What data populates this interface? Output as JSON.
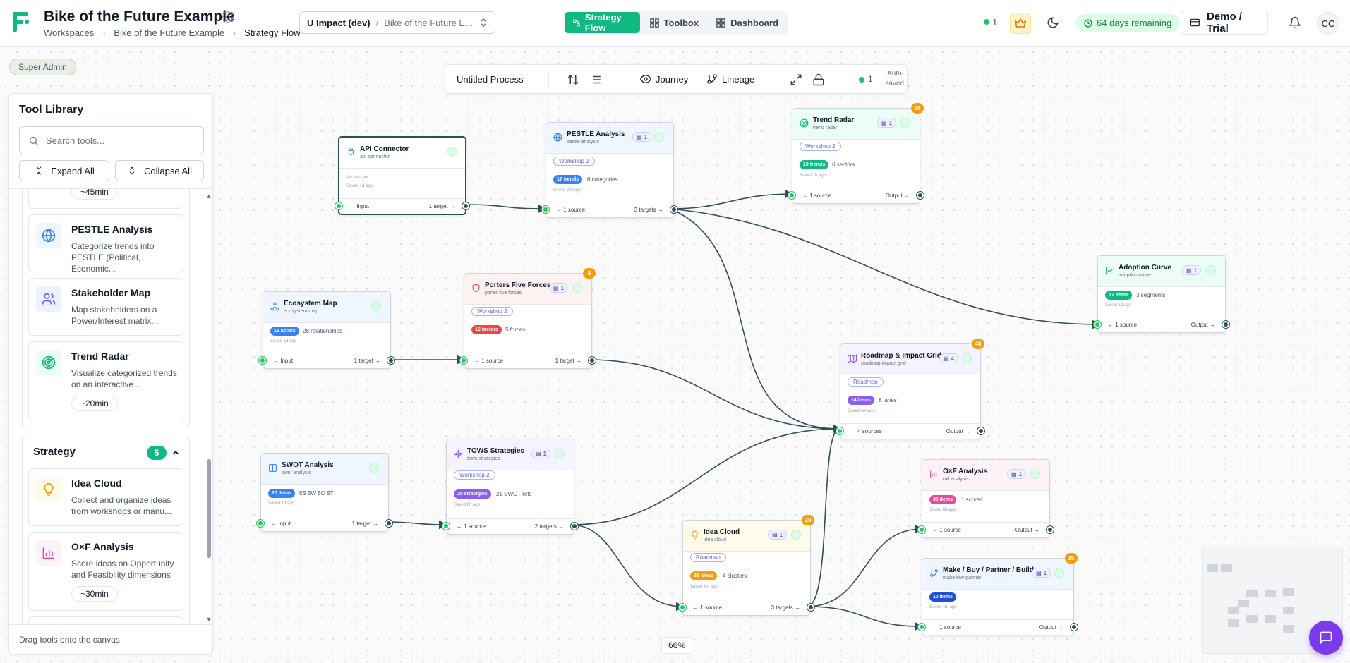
{
  "header": {
    "title": "Bike of the Future Example",
    "breadcrumb": [
      "Workspaces",
      "Bike of the Future Example",
      "Strategy Flow"
    ],
    "workspace_org": "U Impact (dev)",
    "workspace_sep": "/",
    "workspace_project": "Bike of the Future E...",
    "tabs": [
      {
        "label": "Strategy Flow",
        "icon": "flow-icon",
        "active": true
      },
      {
        "label": "Toolbox",
        "icon": "grid-icon",
        "active": false
      },
      {
        "label": "Dashboard",
        "icon": "grid-icon",
        "active": false
      }
    ],
    "online_count": "1",
    "trial_label": "64 days remaining",
    "plan_label": "Demo / Trial",
    "avatar_initials": "CC"
  },
  "admin_badge": "Super Admin",
  "process_bar": {
    "name": "Untitled Process",
    "journey_label": "Journey",
    "lineage_label": "Lineage",
    "presence_count": "1",
    "saved_line1": "Auto-",
    "saved_line2": "saved"
  },
  "library": {
    "title": "Tool Library",
    "search_placeholder": "Search tools...",
    "expand_label": "Expand All",
    "collapse_label": "Collapse All",
    "top_duration": "~45min",
    "tools": [
      {
        "name": "PESTLE Analysis",
        "desc": "Categorize trends into PESTLE (Political, Economic...",
        "icon": "globe-icon"
      },
      {
        "name": "Stakeholder Map",
        "desc": "Map stakeholders on a Power/Interest matrix...",
        "icon": "users-icon"
      },
      {
        "name": "Trend Radar",
        "desc": "Visualize categorized trends on an interactive...",
        "icon": "radar-icon",
        "duration": "~20min"
      }
    ],
    "strategy_section": {
      "label": "Strategy",
      "count": "5"
    },
    "strategy_tools": [
      {
        "name": "Idea Cloud",
        "desc": "Collect and organize ideas from workshops or manu...",
        "icon": "lightbulb-icon"
      },
      {
        "name": "O×F Analysis",
        "desc": "Score ideas on Opportunity and Feasibility dimensions",
        "icon": "bar-chart-icon",
        "duration": "~30min"
      }
    ],
    "footer_hint": "Drag tools onto the canvas"
  },
  "nodes": [
    {
      "id": "api",
      "title": "API Connector",
      "subtitle": "api connector",
      "empty_text": "No data yet",
      "saved": "Saved 1d ago",
      "in_label": "← Input",
      "out_label": "1 target →"
    },
    {
      "id": "pestle",
      "title": "PESTLE Analysis",
      "subtitle": "pestle analysis",
      "chip": "1",
      "tag": "Workshop 2",
      "pill": "17 trends",
      "meta": "6 categories",
      "saved": "Saved 20d ago",
      "in_label": "← 1 source",
      "out_label": "3 targets →"
    },
    {
      "id": "trend",
      "title": "Trend Radar",
      "subtitle": "trend radar",
      "chip": "1",
      "badge": "16",
      "tag": "Workshop 2",
      "pill": "19 trends",
      "meta": "6 sectors",
      "saved": "Saved 7h ago",
      "in_label": "← 1 source",
      "out_label": "Output →"
    },
    {
      "id": "adoption",
      "title": "Adoption Curve",
      "subtitle": "adoption curve",
      "chip": "1",
      "pill": "17 items",
      "meta": "3 segments",
      "saved": "Saved 1d ago",
      "in_label": "← 1 source",
      "out_label": "Output →"
    },
    {
      "id": "eco",
      "title": "Ecosystem Map",
      "subtitle": "ecosystem map",
      "pill": "15 actors",
      "meta": "28 relationships",
      "saved": "Saved 1d ago",
      "in_label": "← Input",
      "out_label": "1 target →"
    },
    {
      "id": "porter",
      "title": "Porters Five Forces",
      "subtitle": "porter five forces",
      "chip": "1",
      "badge": "8",
      "tag": "Workshop 2",
      "pill": "12 factors",
      "meta": "5 forces",
      "in_label": "← 1 source",
      "out_label": "1 target →"
    },
    {
      "id": "roadmap",
      "title": "Roadmap & Impact Grid",
      "subtitle": "roadmap impact grid",
      "chip": "4",
      "badge": "46",
      "tag": "Roadmap",
      "pill": "14 items",
      "meta": "8 lanes",
      "saved": "Saved 4m ago",
      "in_label": "← 4 sources",
      "out_label": "Output →"
    },
    {
      "id": "swot",
      "title": "SWOT Analysis",
      "subtitle": "swot analysis",
      "pill": "20 items",
      "meta": "5S 5W 5O 5T",
      "saved": "Saved 1d ago",
      "in_label": "← Input",
      "out_label": "1 target →"
    },
    {
      "id": "tows",
      "title": "TOWS Strategies",
      "subtitle": "tows strategies",
      "chip": "1",
      "tag": "Workshop 2",
      "pill": "20 strategies",
      "meta": "21 SWOT refs",
      "saved": "Saved 8h ago",
      "in_label": "← 1 source",
      "out_label": "2 targets →"
    },
    {
      "id": "oxf",
      "title": "O×F Analysis",
      "subtitle": "oxf analysis",
      "chip": "1",
      "pill": "35 items",
      "meta": "1 scored",
      "saved": "Saved 8h ago",
      "in_label": "← 1 source",
      "out_label": "Output →"
    },
    {
      "id": "idea",
      "title": "Idea Cloud",
      "subtitle": "idea cloud",
      "chip": "1",
      "badge": "20",
      "tag": "Roadmap",
      "pill": "35 ideas",
      "meta": "4 clusters",
      "saved": "Saved 4m ago",
      "in_label": "← 1 source",
      "out_label": "3 targets →"
    },
    {
      "id": "mbpb",
      "title": "Make / Buy / Partner / Build",
      "subtitle": "make buy partner",
      "chip": "1",
      "badge": "35",
      "pill": "10 items",
      "saved": "Saved 4m ago",
      "in_label": "← 1 source",
      "out_label": "Output →"
    }
  ],
  "zoom_level": "66%",
  "colors": {
    "accent": "#10b981",
    "edge": "#2f4f57",
    "badge_orange": "#f59e0b",
    "chat": "#7c3aed"
  }
}
